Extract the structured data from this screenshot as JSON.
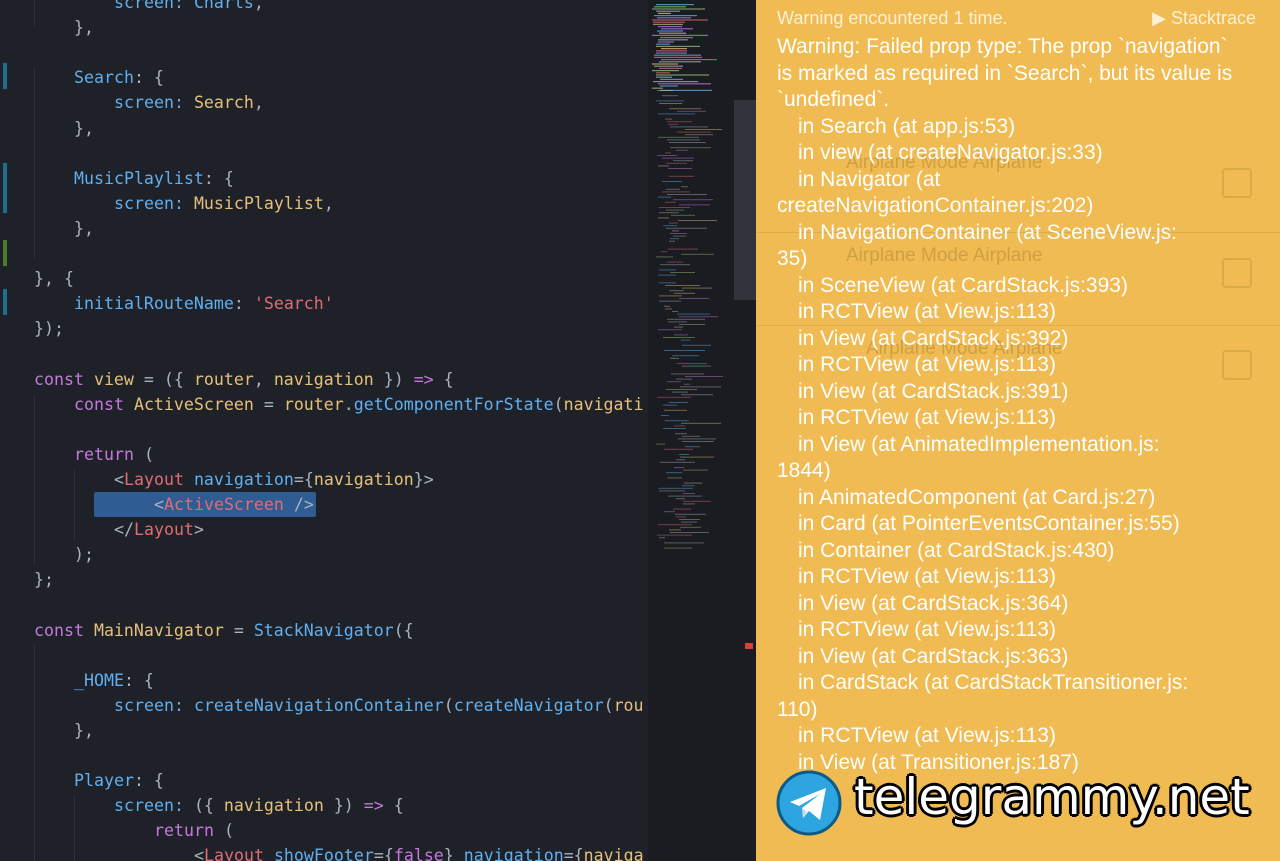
{
  "colors": {
    "editor_bg": "#1e2128",
    "keyword": "#c678dd",
    "property": "#61afef",
    "identifier": "#e5c07b",
    "string": "#e06c75",
    "function": "#61afef",
    "punctuation": "#abb2bf",
    "tag": "#e06c75",
    "warning_bg": "#f0bb52",
    "selection": "#2f5c93"
  },
  "editor": {
    "lines": [
      {
        "indent": 2,
        "tokens": [
          [
            "screen: ",
            "pr"
          ],
          [
            "Charts",
            "fn"
          ],
          [
            ",",
            "pu"
          ]
        ]
      },
      {
        "indent": 1,
        "tokens": [
          [
            "},",
            "pu"
          ]
        ]
      },
      {
        "indent": 0,
        "tokens": []
      },
      {
        "indent": 1,
        "tokens": [
          [
            "Search",
            "pr"
          ],
          [
            ": {",
            "pu"
          ]
        ]
      },
      {
        "indent": 2,
        "tokens": [
          [
            "screen: ",
            "pr"
          ],
          [
            "Search",
            "id"
          ],
          [
            ",",
            "pu"
          ]
        ]
      },
      {
        "indent": 1,
        "tokens": [
          [
            "},",
            "pu"
          ]
        ]
      },
      {
        "indent": 0,
        "tokens": []
      },
      {
        "indent": 1,
        "tokens": [
          [
            "MusicPlaylist",
            "pr"
          ],
          [
            ": {",
            "pu"
          ]
        ]
      },
      {
        "indent": 2,
        "tokens": [
          [
            "screen: ",
            "pr"
          ],
          [
            "MusicPlaylist",
            "id"
          ],
          [
            ",",
            "pu"
          ]
        ]
      },
      {
        "indent": 1,
        "tokens": [
          [
            "},",
            "pu"
          ]
        ]
      },
      {
        "indent": 0,
        "tokens": []
      },
      {
        "indent": 0,
        "tokens": [
          [
            "}, {",
            "pu"
          ]
        ]
      },
      {
        "indent": 1,
        "tokens": [
          [
            "initialRouteName",
            "pr"
          ],
          [
            ": ",
            "pu"
          ],
          [
            "'Search'",
            "st"
          ]
        ]
      },
      {
        "indent": 0,
        "tokens": [
          [
            "});",
            "pu"
          ]
        ]
      },
      {
        "indent": 0,
        "tokens": []
      },
      {
        "indent": 0,
        "tokens": [
          [
            "const ",
            "kw"
          ],
          [
            "view",
            "id"
          ],
          [
            " = ({ ",
            "pu"
          ],
          [
            "router",
            "id"
          ],
          [
            ", ",
            "pu"
          ],
          [
            "navigation",
            "id"
          ],
          [
            " }) ",
            "pu"
          ],
          [
            "=>",
            "kw"
          ],
          [
            " {",
            "pu"
          ]
        ]
      },
      {
        "indent": 1,
        "tokens": [
          [
            "const ",
            "kw"
          ],
          [
            "ActiveScreen",
            "id"
          ],
          [
            " = ",
            "pu"
          ],
          [
            "router",
            "id"
          ],
          [
            ".",
            "pu"
          ],
          [
            "getComponentForState",
            "fn"
          ],
          [
            "(",
            "pu"
          ],
          [
            "navigati",
            "id"
          ]
        ]
      },
      {
        "indent": 0,
        "tokens": []
      },
      {
        "indent": 1,
        "tokens": [
          [
            "return",
            "kw"
          ],
          [
            " (",
            "pu"
          ]
        ]
      },
      {
        "indent": 2,
        "tokens": [
          [
            "<",
            "pu"
          ],
          [
            "Layout",
            "tg"
          ],
          [
            " navigation",
            "pr"
          ],
          [
            "={",
            "pu"
          ],
          [
            "navigation",
            "id"
          ],
          [
            "}>",
            "pu"
          ]
        ]
      },
      {
        "indent": 3,
        "tokens": [
          [
            "<",
            "pu"
          ],
          [
            "ActiveScreen",
            "tg"
          ],
          [
            " />",
            "pu"
          ]
        ]
      },
      {
        "indent": 2,
        "tokens": [
          [
            "</",
            "pu"
          ],
          [
            "Layout",
            "tg"
          ],
          [
            ">",
            "pu"
          ]
        ]
      },
      {
        "indent": 1,
        "tokens": [
          [
            ");",
            "pu"
          ]
        ]
      },
      {
        "indent": 0,
        "tokens": [
          [
            "};",
            "pu"
          ]
        ]
      },
      {
        "indent": 0,
        "tokens": []
      },
      {
        "indent": 0,
        "tokens": [
          [
            "const ",
            "kw"
          ],
          [
            "MainNavigator",
            "id"
          ],
          [
            " = ",
            "pu"
          ],
          [
            "StackNavigator",
            "fn"
          ],
          [
            "({",
            "pu"
          ]
        ]
      },
      {
        "indent": 0,
        "tokens": []
      },
      {
        "indent": 1,
        "tokens": [
          [
            "_HOME",
            "pr"
          ],
          [
            ": {",
            "pu"
          ]
        ]
      },
      {
        "indent": 2,
        "tokens": [
          [
            "screen: ",
            "pr"
          ],
          [
            "createNavigationContainer",
            "fn"
          ],
          [
            "(",
            "pu"
          ],
          [
            "createNavigator",
            "fn"
          ],
          [
            "(",
            "pu"
          ],
          [
            "rou",
            "id"
          ]
        ]
      },
      {
        "indent": 1,
        "tokens": [
          [
            "},",
            "pu"
          ]
        ]
      },
      {
        "indent": 0,
        "tokens": []
      },
      {
        "indent": 1,
        "tokens": [
          [
            "Player",
            "pr"
          ],
          [
            ": {",
            "pu"
          ]
        ]
      },
      {
        "indent": 2,
        "tokens": [
          [
            "screen: ",
            "pr"
          ],
          [
            "({ ",
            "pu"
          ],
          [
            "navigation",
            "id"
          ],
          [
            " }) ",
            "pu"
          ],
          [
            "=>",
            "kw"
          ],
          [
            " {",
            "pu"
          ]
        ]
      },
      {
        "indent": 3,
        "tokens": [
          [
            "return",
            "kw"
          ],
          [
            " (",
            "pu"
          ]
        ]
      },
      {
        "indent": 4,
        "tokens": [
          [
            "<",
            "pu"
          ],
          [
            "Layout",
            "tg"
          ],
          [
            " showFooter",
            "pr"
          ],
          [
            "={",
            "pu"
          ],
          [
            "false",
            "kw"
          ],
          [
            "} ",
            "pu"
          ],
          [
            "navigation",
            "pr"
          ],
          [
            "={",
            "pu"
          ],
          [
            "naviga",
            "id"
          ]
        ]
      }
    ]
  },
  "simulator_ghost": {
    "title": "Airplane Mode Airplane",
    "titles": [
      "Airplane Mode Airplane",
      "Airplane Mode Airplane"
    ]
  },
  "redbox": {
    "header_count": "Warning encountered 1 time.",
    "header_trace": "▶ Stacktrace",
    "message": "Warning: Failed prop type: The prop `navigation` is marked as required in `Search`, but its value is `undefined`.",
    "stack": [
      {
        "text": "in Search (at app.js:53)"
      },
      {
        "text": "in view (at createNavigator.js:33)"
      },
      {
        "text": "in Navigator (at",
        "wrap": "createNavigationContainer.js:202)"
      },
      {
        "text": "in NavigationContainer (at SceneView.js:",
        "wrap": "35)"
      },
      {
        "text": "in SceneView (at CardStack.js:393)"
      },
      {
        "text": "in RCTView (at View.js:113)"
      },
      {
        "text": "in View (at CardStack.js:392)"
      },
      {
        "text": "in RCTView (at View.js:113)"
      },
      {
        "text": "in View (at CardStack.js:391)"
      },
      {
        "text": "in RCTView (at View.js:113)"
      },
      {
        "text": "in View (at AnimatedImplementation.js:",
        "wrap": "1844)"
      },
      {
        "text": "in AnimatedComponent (at Card.js:27)"
      },
      {
        "text": "in Card (at PointerEventsContainer.js:55)"
      },
      {
        "text": "in Container (at CardStack.js:430)"
      },
      {
        "text": "in RCTView (at View.js:113)"
      },
      {
        "text": "in View (at CardStack.js:364)"
      },
      {
        "text": "in RCTView (at View.js:113)"
      },
      {
        "text": "in View (at CardStack.js:363)"
      },
      {
        "text": "in CardStack (at CardStackTransitioner.js:",
        "wrap": "110)"
      },
      {
        "text": "in RCTView (at View.js:113)"
      },
      {
        "text": "in View (at Transitioner.js:187)"
      }
    ]
  },
  "watermark": {
    "text": "telegrammy.net",
    "icon": "telegram-logo-icon"
  }
}
